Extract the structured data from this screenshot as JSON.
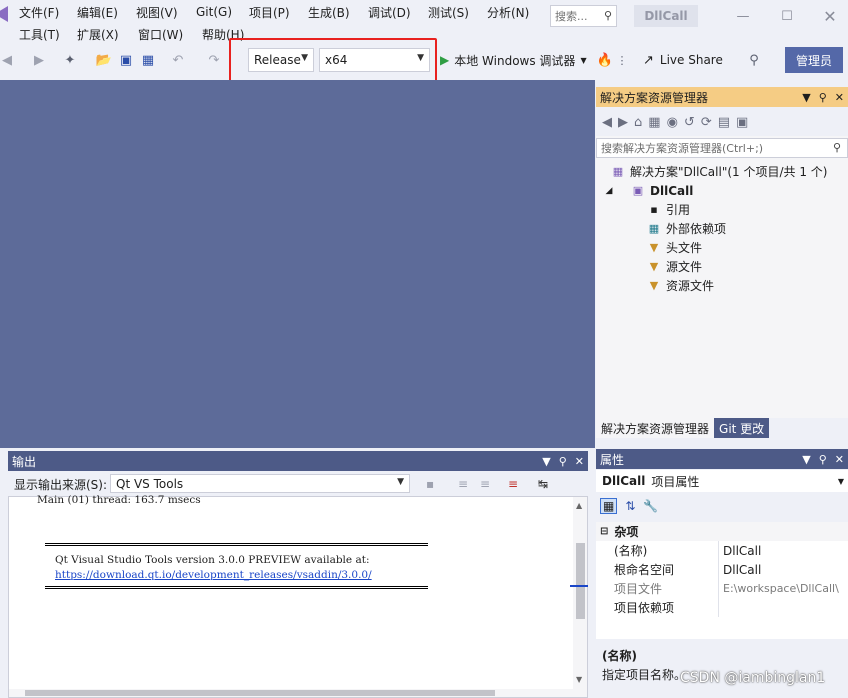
{
  "menu": {
    "row1": [
      "文件(F)",
      "编辑(E)",
      "视图(V)",
      "Git(G)",
      "项目(P)",
      "生成(B)",
      "调试(D)",
      "测试(S)",
      "分析(N)"
    ],
    "row2": [
      "工具(T)",
      "扩展(X)",
      "窗口(W)",
      "帮助(H)"
    ]
  },
  "search": {
    "placeholder": "搜索..."
  },
  "app_title": "DllCall",
  "toolbar": {
    "configuration": "Release",
    "platform": "x64",
    "run_label": "本地 Windows 调试器",
    "live_share": "Live Share",
    "admin": "管理员"
  },
  "solution_explorer": {
    "title": "解决方案资源管理器",
    "search_placeholder": "搜索解决方案资源管理器(Ctrl+;)",
    "solution": "解决方案\"DllCall\"(1 个项目/共 1 个)",
    "project": "DllCall",
    "items": [
      "引用",
      "外部依赖项",
      "头文件",
      "源文件",
      "资源文件"
    ],
    "tabs": [
      "解决方案资源管理器",
      "Git 更改"
    ]
  },
  "output": {
    "title": "输出",
    "source_label": "显示输出来源(S):",
    "source_value": "Qt VS Tools",
    "lines": [
      "Main (01) thread: 163.7 msecs",
      "Qt Visual Studio Tools version 3.0.0 PREVIEW available at:",
      "https://download.qt.io/development_releases/vsaddin/3.0.0/"
    ]
  },
  "properties": {
    "title": "属性",
    "object_name": "DllCall",
    "object_type": "项目属性",
    "category": "杂项",
    "rows": [
      {
        "key": "(名称)",
        "value": "DllCall"
      },
      {
        "key": "根命名空间",
        "value": "DllCall"
      },
      {
        "key": "项目文件",
        "value": "E:\\workspace\\DllCall\\"
      },
      {
        "key": "项目依赖项",
        "value": ""
      }
    ],
    "desc_title": "(名称)",
    "desc_text": "指定项目名称。"
  },
  "watermark": "CSDN @iambinglan1",
  "colors": {
    "accent": "#5468a8",
    "editor_bg": "#5d6b99",
    "highlight": "#e8211f",
    "panel_active": "#f5cc84"
  }
}
